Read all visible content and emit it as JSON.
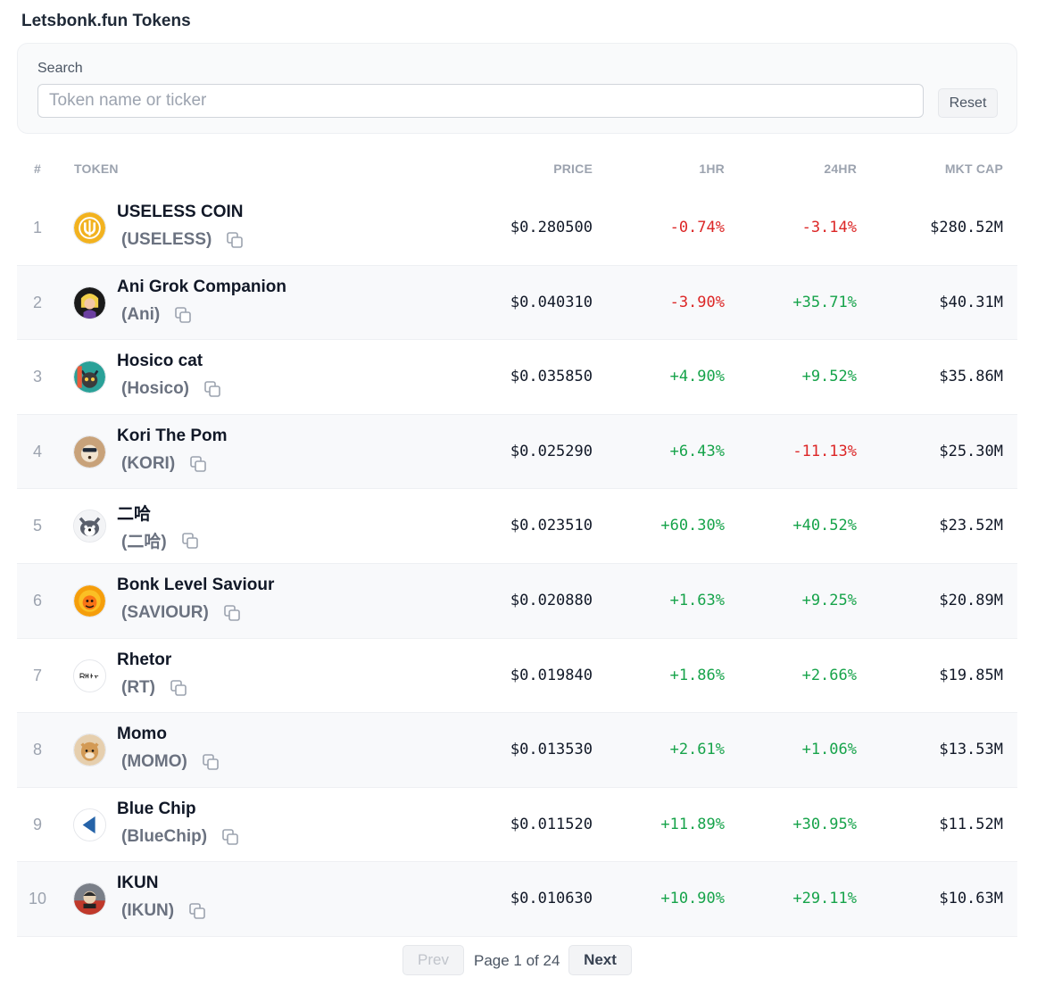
{
  "page": {
    "title": "Letsbonk.fun Tokens"
  },
  "search": {
    "label": "Search",
    "placeholder": "Token name or ticker",
    "value": "",
    "reset_label": "Reset"
  },
  "table": {
    "columns": {
      "rank": "#",
      "token": "TOKEN",
      "price": "PRICE",
      "h1": "1HR",
      "h24": "24HR",
      "mcap": "MKT CAP"
    },
    "rows": [
      {
        "rank": "1",
        "name": "USELESS COIN",
        "ticker": "(USELESS)",
        "price": "$0.280500",
        "h1": "-0.74%",
        "h24": "-3.14%",
        "mcap": "$280.52M",
        "logo_icon": "useless-coin-logo-icon",
        "logo_color": "#f2b21f"
      },
      {
        "rank": "2",
        "name": "Ani Grok Companion",
        "ticker": "(Ani)",
        "price": "$0.040310",
        "h1": "-3.90%",
        "h24": "+35.71%",
        "mcap": "$40.31M",
        "logo_icon": "ani-logo-icon",
        "logo_color": "#1a1a1a"
      },
      {
        "rank": "3",
        "name": "Hosico cat",
        "ticker": "(Hosico)",
        "price": "$0.035850",
        "h1": "+4.90%",
        "h24": "+9.52%",
        "mcap": "$35.86M",
        "logo_icon": "hosico-logo-icon",
        "logo_color": "#2aa198"
      },
      {
        "rank": "4",
        "name": "Kori The Pom",
        "ticker": "(KORI)",
        "price": "$0.025290",
        "h1": "+6.43%",
        "h24": "-11.13%",
        "mcap": "$25.30M",
        "logo_icon": "kori-logo-icon",
        "logo_color": "#c8a27a"
      },
      {
        "rank": "5",
        "name": "二哈",
        "ticker": "(二哈)",
        "price": "$0.023510",
        "h1": "+60.30%",
        "h24": "+40.52%",
        "mcap": "$23.52M",
        "logo_icon": "husky-logo-icon",
        "logo_color": "#5a5f6b"
      },
      {
        "rank": "6",
        "name": "Bonk Level Saviour",
        "ticker": "(SAVIOUR)",
        "price": "$0.020880",
        "h1": "+1.63%",
        "h24": "+9.25%",
        "mcap": "$20.89M",
        "logo_icon": "bonk-saviour-logo-icon",
        "logo_color": "#f59e0b"
      },
      {
        "rank": "7",
        "name": "Rhetor",
        "ticker": "(RT)",
        "price": "$0.019840",
        "h1": "+1.86%",
        "h24": "+2.66%",
        "mcap": "$19.85M",
        "logo_icon": "rhetor-logo-icon",
        "logo_color": "#ffffff"
      },
      {
        "rank": "8",
        "name": "Momo",
        "ticker": "(MOMO)",
        "price": "$0.013530",
        "h1": "+2.61%",
        "h24": "+1.06%",
        "mcap": "$13.53M",
        "logo_icon": "momo-logo-icon",
        "logo_color": "#d39a55"
      },
      {
        "rank": "9",
        "name": "Blue Chip",
        "ticker": "(BlueChip)",
        "price": "$0.011520",
        "h1": "+11.89%",
        "h24": "+30.95%",
        "mcap": "$11.52M",
        "logo_icon": "bluechip-logo-icon",
        "logo_color": "#2563a8"
      },
      {
        "rank": "10",
        "name": "IKUN",
        "ticker": "(IKUN)",
        "price": "$0.010630",
        "h1": "+10.90%",
        "h24": "+29.11%",
        "mcap": "$10.63M",
        "logo_icon": "ikun-logo-icon",
        "logo_color": "#7a7f88"
      }
    ]
  },
  "pagination": {
    "prev_label": "Prev",
    "page_info": "Page 1 of 24",
    "next_label": "Next"
  },
  "colors": {
    "negative": "#dc2626",
    "positive": "#16a34a",
    "muted": "#9ca3af"
  }
}
